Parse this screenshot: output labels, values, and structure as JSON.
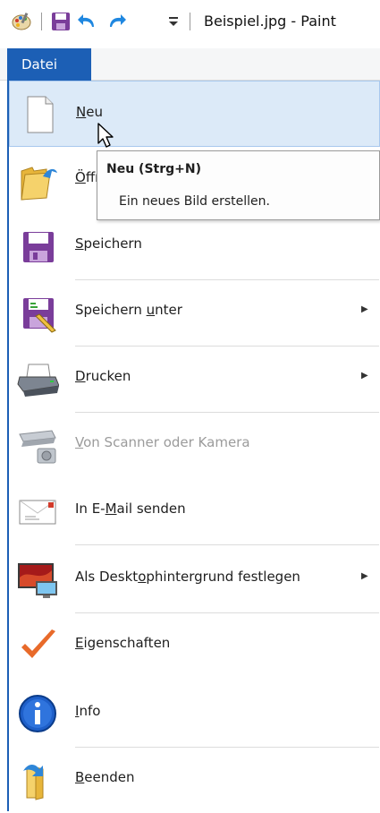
{
  "window": {
    "title": "Beispiel.jpg - Paint"
  },
  "quick_access": {
    "icons": [
      "paint-palette-icon",
      "save-icon",
      "undo-icon",
      "redo-icon",
      "customize-dropdown-icon"
    ]
  },
  "menu_bar": {
    "file_tab": "Datei"
  },
  "file_menu": {
    "items": [
      {
        "pre": "",
        "key": "N",
        "post": "eu",
        "icon": "new-document-icon",
        "disabled": false,
        "submenu": false
      },
      {
        "pre": "",
        "key": "Ö",
        "post": "ffnen",
        "icon": "open-folder-icon",
        "disabled": false,
        "submenu": false
      },
      {
        "pre": "",
        "key": "S",
        "post": "peichern",
        "icon": "save-icon",
        "disabled": false,
        "submenu": false
      },
      {
        "pre": "Speichern ",
        "key": "u",
        "post": "nter",
        "icon": "save-as-icon",
        "disabled": false,
        "submenu": true
      },
      {
        "pre": "",
        "key": "D",
        "post": "rucken",
        "icon": "printer-icon",
        "disabled": false,
        "submenu": true
      },
      {
        "pre": "",
        "key": "V",
        "post": "on Scanner oder Kamera",
        "icon": "scanner-camera-icon",
        "disabled": true,
        "submenu": false
      },
      {
        "pre": "In E-",
        "key": "M",
        "post": "ail senden",
        "icon": "email-icon",
        "disabled": false,
        "submenu": false
      },
      {
        "pre": "Als Deskt",
        "key": "o",
        "post": "phintergrund festlegen",
        "icon": "desktop-background-icon",
        "disabled": false,
        "submenu": true
      },
      {
        "pre": "",
        "key": "E",
        "post": "igenschaften",
        "icon": "properties-checkmark-icon",
        "disabled": false,
        "submenu": false
      },
      {
        "pre": "",
        "key": "I",
        "post": "nfo",
        "icon": "info-icon",
        "disabled": false,
        "submenu": false
      },
      {
        "pre": "",
        "key": "B",
        "post": "eenden",
        "icon": "exit-icon",
        "disabled": false,
        "submenu": false
      }
    ]
  },
  "tooltip": {
    "title": "Neu (Strg+N)",
    "description": "Ein neues Bild erstellen."
  }
}
